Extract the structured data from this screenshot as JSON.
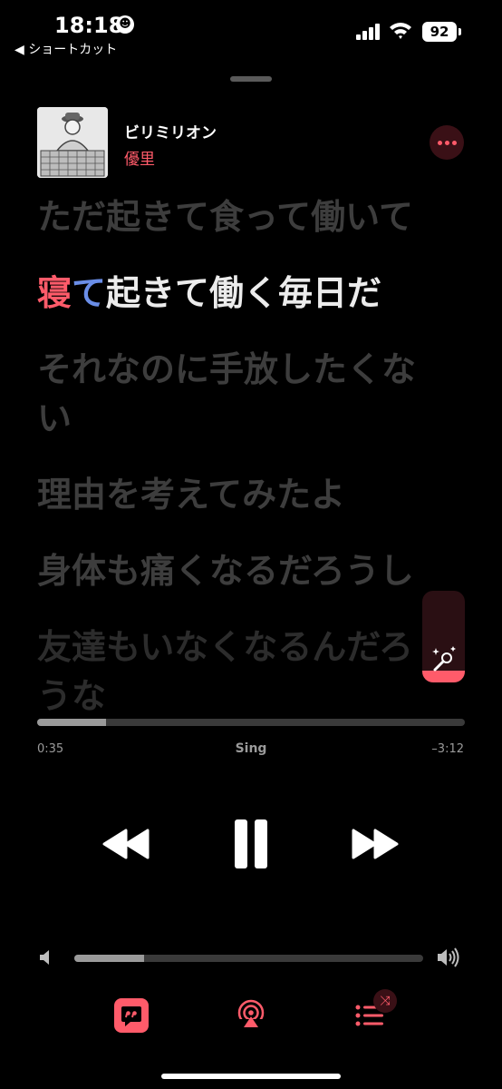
{
  "status_bar": {
    "time": "18:18",
    "focus_symbol": "☻",
    "back_label": "◀ ショートカット",
    "battery": "92"
  },
  "now_playing": {
    "title": "ビリミリオン",
    "artist": "優里"
  },
  "lyrics": {
    "line_1": "ただ起きて食って働いて",
    "active_line": {
      "sung_1": "寝",
      "sung_2": "て",
      "rest": "起きて働く毎日だ"
    },
    "line_3": "それなのに手放したくない",
    "line_4": "理由を考えてみたよ",
    "line_5": "身体も痛くなるだろうし",
    "line_6": "友達もいなくなるんだろうな"
  },
  "sing_slider": {
    "level": 0.13
  },
  "playback": {
    "elapsed": "0:35",
    "mode_label": "Sing",
    "remaining": "–3:12",
    "progress": 0.16
  },
  "volume": {
    "level": 0.2
  },
  "toolbar": {
    "shuffle_symbol": "⤨"
  },
  "colors": {
    "accent": "#ff5b6a",
    "background": "#000000",
    "active_lyric": "#ececec",
    "inactive_lyric": "#3d3d3d",
    "sung_blue": "#6a8ee8"
  },
  "icons": [
    "focus-icon",
    "cellular-signal-icon",
    "wifi-icon",
    "battery-icon",
    "more-icon",
    "microphone-sparkle-icon",
    "rewind-icon",
    "pause-icon",
    "fast-forward-icon",
    "volume-low-icon",
    "volume-high-icon",
    "lyrics-icon",
    "airplay-icon",
    "queue-icon",
    "shuffle-icon"
  ]
}
